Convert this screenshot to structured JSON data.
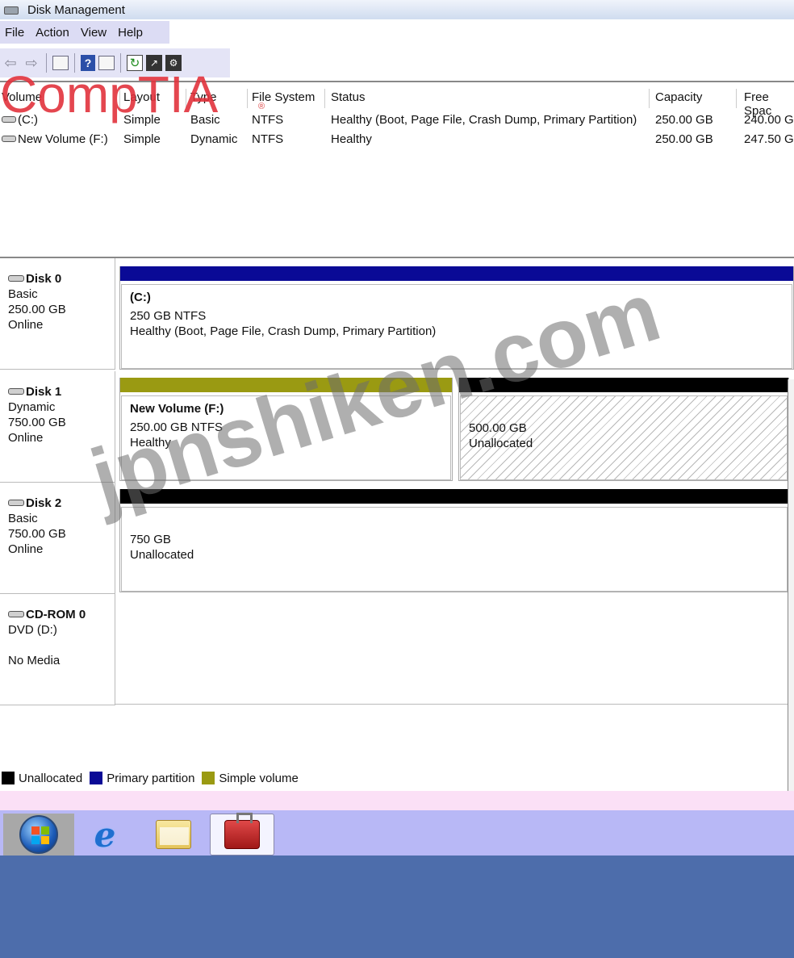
{
  "window": {
    "title": "Disk Management"
  },
  "menu": [
    "File",
    "Action",
    "View",
    "Help"
  ],
  "toolbar": {
    "icons": [
      "back-icon",
      "forward-icon",
      "console-tree-icon",
      "help-icon",
      "properties-icon",
      "refresh-icon",
      "export-icon",
      "settings-icon"
    ]
  },
  "logo": {
    "text": "CompTIA",
    "reg": "®"
  },
  "volume_list": {
    "columns": [
      "Volume",
      "Layout",
      "Type",
      "File System",
      "Status",
      "Capacity",
      "Free Spac"
    ],
    "rows": [
      {
        "volume": "(C:)",
        "layout": "Simple",
        "type": "Basic",
        "fs": "NTFS",
        "status": "Healthy (Boot, Page File, Crash Dump, Primary Partition)",
        "capacity": "250.00 GB",
        "free": "240.00 G"
      },
      {
        "volume": "New Volume (F:)",
        "layout": "Simple",
        "type": "Dynamic",
        "fs": "NTFS",
        "status": "Healthy",
        "capacity": "250.00 GB",
        "free": "247.50 G"
      }
    ]
  },
  "disks": [
    {
      "name": "Disk 0",
      "type": "Basic",
      "size": "250.00 GB",
      "state": "Online",
      "partitions": [
        {
          "title": "(C:)",
          "line1": "250 GB NTFS",
          "line2": "Healthy (Boot, Page File, Crash Dump, Primary Partition)",
          "kind": "primary"
        }
      ]
    },
    {
      "name": "Disk 1",
      "type": "Dynamic",
      "size": "750.00 GB",
      "state": "Online",
      "partitions": [
        {
          "title": "New Volume  (F:)",
          "line1": "250.00 GB NTFS",
          "line2": "Healthy",
          "kind": "simple"
        },
        {
          "title": "",
          "line1": "500.00 GB",
          "line2": "Unallocated",
          "kind": "unallocated"
        }
      ]
    },
    {
      "name": "Disk 2",
      "type": "Basic",
      "size": "750.00 GB",
      "state": "Online",
      "partitions": [
        {
          "title": "",
          "line1": "750 GB",
          "line2": "Unallocated",
          "kind": "unallocated"
        }
      ]
    },
    {
      "name": "CD-ROM 0",
      "type": "DVD (D:)",
      "size": "",
      "state": "No Media",
      "partitions": []
    }
  ],
  "legend": [
    {
      "label": "Unallocated",
      "color": "#000000"
    },
    {
      "label": "Primary partition",
      "color": "#0a0a96"
    },
    {
      "label": "Simple volume",
      "color": "#9a9a12"
    }
  ],
  "colors": {
    "primary": "#0a0a96",
    "simple": "#9a9a12",
    "unallocated": "#000000"
  },
  "taskbar": {
    "apps": [
      "start-orb-icon",
      "internet-explorer-icon",
      "explorer-folder-icon",
      "computer-management-icon"
    ]
  },
  "watermark": "jpnshiken.com"
}
